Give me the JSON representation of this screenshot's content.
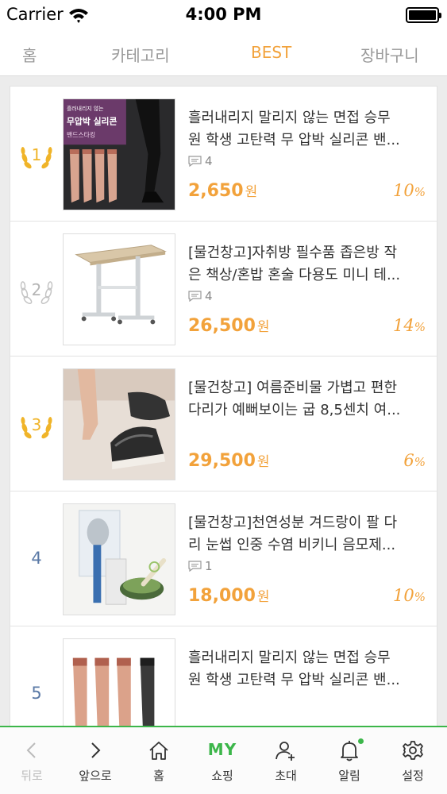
{
  "status_bar": {
    "carrier": "Carrier",
    "time": "4:00 PM"
  },
  "tabs": [
    {
      "label": "홈",
      "active": false
    },
    {
      "label": "카테고리",
      "active": false
    },
    {
      "label": "BEST",
      "active": true
    },
    {
      "label": "장바구니",
      "active": false
    }
  ],
  "items": [
    {
      "rank": "1",
      "rank_style": "gold-wreath",
      "title_line1": "흘러내리지 말리지 않는 면접 승무",
      "title_line2": "원 학생 고탄력 무 압박 실리콘 밴...",
      "comments": "4",
      "price": "2,650",
      "currency": "원",
      "discount": "10",
      "discount_unit": "%",
      "image_text_1": "무압박 실리콘",
      "image_text_2": "밴드스타킹"
    },
    {
      "rank": "2",
      "rank_style": "silver-wreath",
      "title_line1": "[물건창고]자취방 필수품 좁은방 작",
      "title_line2": "은 책상/혼밥 혼술 다용도 미니 테...",
      "comments": "4",
      "price": "26,500",
      "currency": "원",
      "discount": "14",
      "discount_unit": "%"
    },
    {
      "rank": "3",
      "rank_style": "gold-wreath",
      "title_line1": "[물건창고] 여름준비물 가볍고 편한",
      "title_line2": "다리가 예뻐보이는 굽 8,5센치 여...",
      "comments": "",
      "price": "29,500",
      "currency": "원",
      "discount": "6",
      "discount_unit": "%"
    },
    {
      "rank": "4",
      "rank_style": "plain",
      "title_line1": "[물건창고]천연성분 겨드랑이 팔 다",
      "title_line2": "리 눈썹 인중 수염 비키니 음모제...",
      "comments": "1",
      "price": "18,000",
      "currency": "원",
      "discount": "10",
      "discount_unit": "%"
    },
    {
      "rank": "5",
      "rank_style": "plain",
      "title_line1": "흘러내리지 말리지 않는 면접 승무",
      "title_line2": "원 학생 고탄력 무 압박 실리콘 밴...",
      "comments": "",
      "price": "",
      "currency": "",
      "discount": "",
      "discount_unit": ""
    }
  ],
  "bottom_nav": [
    {
      "label": "뒤로",
      "icon": "back-chevron-icon",
      "disabled": true
    },
    {
      "label": "앞으로",
      "icon": "forward-chevron-icon",
      "disabled": false
    },
    {
      "label": "홈",
      "icon": "home-icon",
      "disabled": false
    },
    {
      "label": "쇼핑",
      "icon_text": "MY",
      "disabled": false
    },
    {
      "label": "초대",
      "icon": "add-user-icon",
      "disabled": false
    },
    {
      "label": "알림",
      "icon": "bell-icon",
      "disabled": false,
      "has_new": true
    },
    {
      "label": "설정",
      "icon": "gear-icon",
      "disabled": false
    }
  ],
  "colors": {
    "accent": "#f2a23b",
    "brand_green": "#3cb64a",
    "rank_blue": "#5a79a6",
    "gold": "#f0b429",
    "silver": "#c4c4c4"
  }
}
